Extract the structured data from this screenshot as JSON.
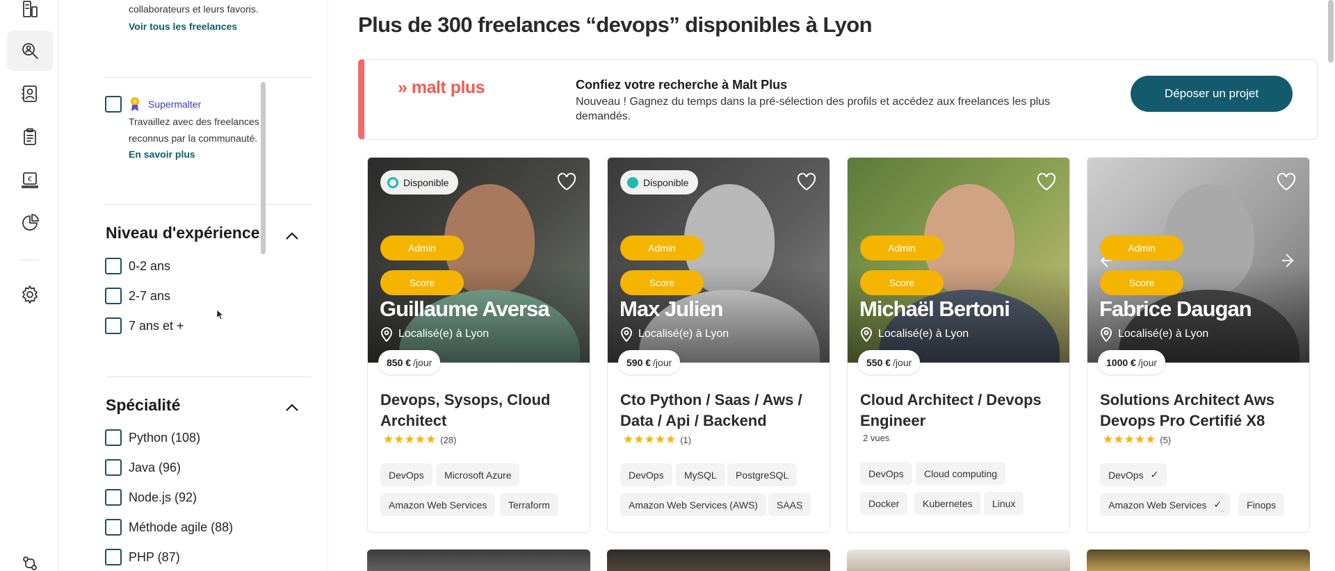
{
  "sidebar": {
    "favoris_text": "collaborateurs et leurs favoris.",
    "voir_tous": "Voir tous les freelances",
    "supermalter_label": "Supermalter",
    "supermalter_desc_1": "Travaillez avec des freelances",
    "supermalter_desc_2": "reconnus par la communauté.",
    "en_savoir_plus": "En savoir plus",
    "experience": {
      "title": "Niveau d'expérience",
      "options": [
        "0-2 ans",
        "2-7 ans",
        "7 ans et +"
      ]
    },
    "specialite": {
      "title": "Spécialité",
      "options": [
        "Python (108)",
        "Java (96)",
        "Node.js (92)",
        "Méthode agile (88)",
        "PHP (87)"
      ]
    }
  },
  "main": {
    "title": "Plus de 300 freelances “devops” disponibles à Lyon",
    "banner": {
      "logo": "» malt plus",
      "title": "Confiez votre recherche à Malt Plus",
      "text": "Nouveau ! Gagnez du temps dans la pré-sélection des profils et accédez aux freelances les plus demandés.",
      "button": "Déposer un projet"
    },
    "cards": [
      {
        "dispo": "Disponible",
        "admin": "Admin",
        "score": "Score",
        "name": "Guillaume Aversa",
        "location": "Localisé(e) à Lyon",
        "price_value": "850 €",
        "price_unit": "/jour",
        "title": "Devops, Sysops, Cloud Architect",
        "stars": "★★★★★",
        "reviews": "(28)",
        "tags": [
          "DevOps",
          "Microsoft Azure",
          "Amazon Web Services",
          "Terraform"
        ]
      },
      {
        "dispo": "Disponible",
        "admin": "Admin",
        "score": "Score",
        "name": "Max Julien",
        "location": "Localisé(e) à Lyon",
        "price_value": "590 €",
        "price_unit": "/jour",
        "title": "Cto Python / Saas / Aws / Data / Api / Backend",
        "stars": "★★★★★",
        "reviews": "(1)",
        "tags": [
          "DevOps",
          "MySQL",
          "PostgreSQL",
          "Amazon Web Services (AWS)",
          "SAAS"
        ]
      },
      {
        "admin": "Admin",
        "score": "Score",
        "name": "Michaël Bertoni",
        "location": "Localisé(e) à Lyon",
        "price_value": "550 €",
        "price_unit": "/jour",
        "title": "Cloud Architect / Devops Engineer",
        "views": "2  vues",
        "tags": [
          "DevOps",
          "Cloud computing",
          "Docker",
          "Kubernetes",
          "Linux"
        ]
      },
      {
        "admin": "Admin",
        "score": "Score",
        "name": "Fabrice Daugan",
        "location": "Localisé(e) à Lyon",
        "price_value": "1000 €",
        "price_unit": "/jour",
        "title": "Solutions Architect Aws Devops Pro Certifié X8",
        "stars": "★★★★★",
        "reviews": "(5)",
        "tags": [
          "DevOps",
          "Amazon Web Services",
          "Finops"
        ],
        "tick": "✓"
      }
    ]
  },
  "colors": {
    "accent": "#135b6c",
    "malt": "#f25c54",
    "pill": "#f4b400",
    "available": "#22b8b0"
  }
}
